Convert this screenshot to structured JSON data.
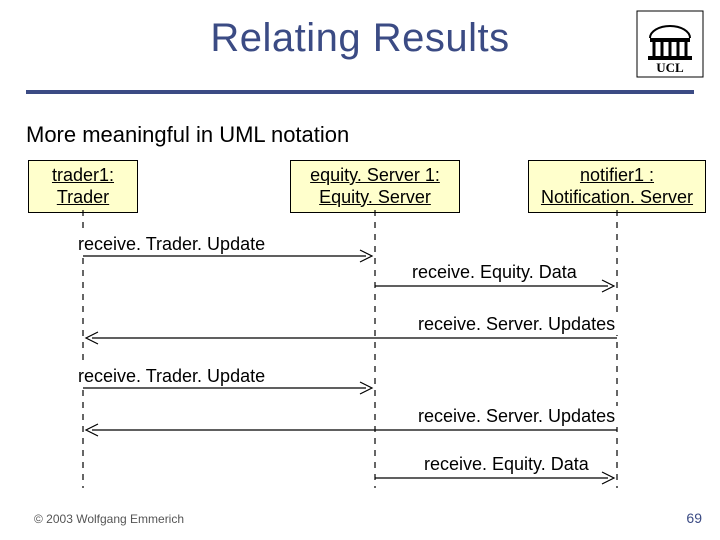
{
  "title": "Relating Results",
  "subtitle": "More meaningful in UML notation",
  "footer": {
    "copyright": "© 2003 Wolfgang Emmerich",
    "page_number": "69"
  },
  "logo": "UCL",
  "lifelines": {
    "l1": {
      "name": "trader1:",
      "type": "Trader"
    },
    "l2": {
      "name": "equity. Server 1:",
      "type": "Equity. Server"
    },
    "l3": {
      "name": "notifier1 :",
      "type": "Notification. Server"
    }
  },
  "messages": {
    "m1": "receive. Trader. Update",
    "m2": "receive. Equity. Data",
    "m3": "receive. Server. Updates",
    "m4": "receive. Trader. Update",
    "m5": "receive. Server. Updates",
    "m6": "receive. Equity. Data"
  }
}
